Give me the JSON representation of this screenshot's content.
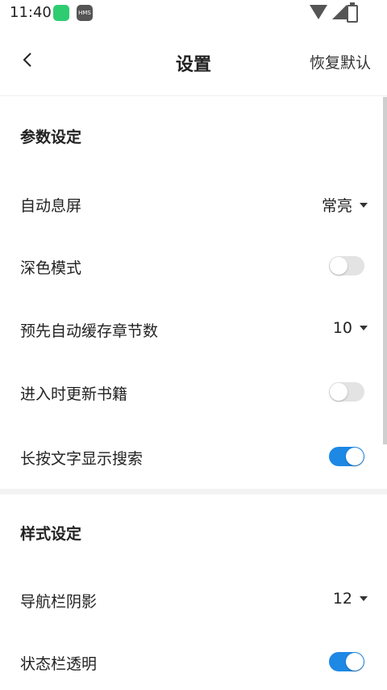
{
  "status_bar": {
    "time": "11:40",
    "hms_label": "HMS",
    "icons": [
      "app-g-icon",
      "hms-icon",
      "wifi-icon",
      "signal-icon",
      "battery-icon"
    ]
  },
  "header": {
    "title": "设置",
    "reset_label": "恢复默认"
  },
  "sections": {
    "params": {
      "title": "参数设定",
      "auto_screen": {
        "label": "自动息屏",
        "value": "常亮"
      },
      "dark_mode": {
        "label": "深色模式",
        "on": false
      },
      "precache": {
        "label": "预先自动缓存章节数",
        "value": "10"
      },
      "update_on_enter": {
        "label": "进入时更新书籍",
        "on": false
      },
      "long_press_search": {
        "label": "长按文字显示搜索",
        "on": true
      }
    },
    "style": {
      "title": "样式设定",
      "nav_shadow": {
        "label": "导航栏阴影",
        "value": "12"
      },
      "status_transparent": {
        "label": "状态栏透明",
        "on": true
      }
    }
  },
  "colors": {
    "accent": "#1e88e5",
    "toggle_off": "#e3e3e3"
  }
}
